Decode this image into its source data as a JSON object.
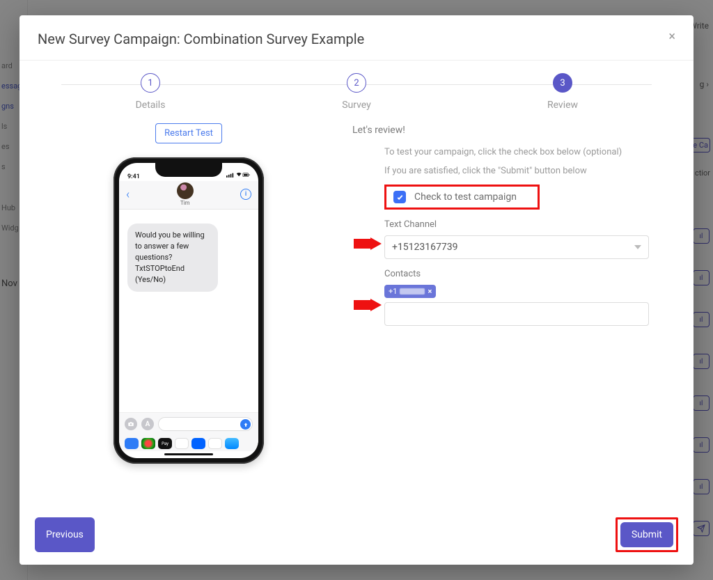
{
  "modal": {
    "title": "New Survey Campaign: Combination Survey Example",
    "close": "×"
  },
  "stepper": {
    "steps": [
      {
        "num": "1",
        "label": "Details"
      },
      {
        "num": "2",
        "label": "Survey"
      },
      {
        "num": "3",
        "label": "Review"
      }
    ]
  },
  "left": {
    "restart": "Restart Test",
    "phone": {
      "time": "9:41",
      "contact_name": "Tim",
      "message": "Would you be willing to answer a few questions? TxtSTOPtoEnd (Yes/No)"
    }
  },
  "review": {
    "heading": "Let's review!",
    "hint_test": "To test your campaign, click the check box below (optional)",
    "hint_submit": "If you are satisfied, click the \"Submit\" button below",
    "checkbox_label": "Check to test campaign",
    "checkbox_checked": true,
    "text_channel_label": "Text Channel",
    "text_channel_value": "+15123167739",
    "contacts_label": "Contacts",
    "contact_chip_prefix": "+1",
    "contacts_input_value": ""
  },
  "footer": {
    "previous": "Previous",
    "submit": "Submit"
  },
  "bg": {
    "sidebar": [
      "ard",
      "essag",
      "gns",
      "ls",
      "es",
      "s",
      "Hub",
      "Widg",
      "Nov"
    ],
    "right_partial_top": "Write",
    "right_partial_1": "g   ›",
    "right_partial_2": "e Ca",
    "right_partial_3": "ctior"
  }
}
